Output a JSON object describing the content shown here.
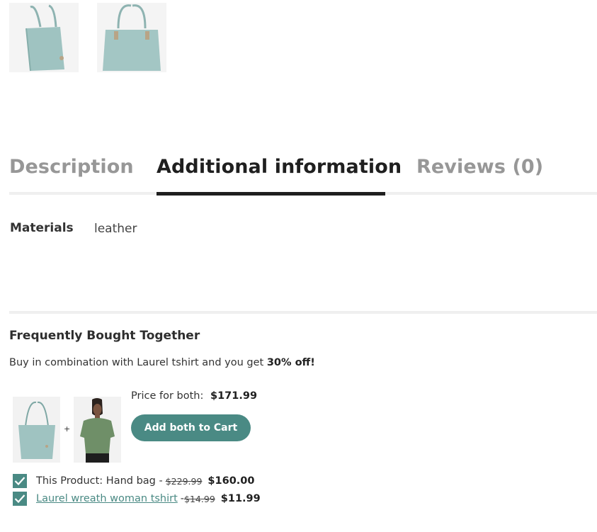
{
  "gallery": {
    "thumbnails": [
      {
        "alt": "hand-bag-thumbnail-side"
      },
      {
        "alt": "hand-bag-thumbnail-front"
      }
    ]
  },
  "tabs": [
    {
      "label": "Description",
      "active": false
    },
    {
      "label": "Additional information",
      "active": true
    },
    {
      "label": "Reviews (0)",
      "active": false
    }
  ],
  "additional_info": {
    "rows": [
      {
        "label": "Materials",
        "value": "leather"
      }
    ]
  },
  "fbt": {
    "title": "Frequently Bought Together",
    "desc_prefix": "Buy in combination with Laurel tshirt and you get ",
    "desc_discount": "30% off!",
    "plus": "+",
    "price_label": "Price for both:",
    "price_total": "$171.99",
    "add_button": "Add both to Cart",
    "items": [
      {
        "prefix": "This Product: Hand bag - ",
        "old_price": "$229.99",
        "new_price": "$160.00",
        "checked": true,
        "is_link": false
      },
      {
        "prefix": "Laurel wreath woman tshirt ",
        "separator": "- ",
        "old_price": "$14.99",
        "new_price": "$11.99",
        "checked": true,
        "is_link": true
      }
    ]
  },
  "colors": {
    "accent": "#4a8a84",
    "bag": "#9fc3c1",
    "tab_inactive": "#979797",
    "tab_active": "#1f1f1f",
    "shirt": "#6f8f68"
  }
}
